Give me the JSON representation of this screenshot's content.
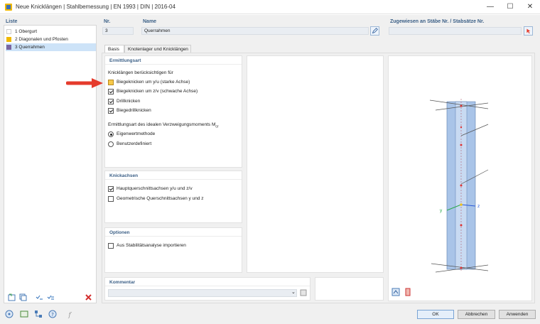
{
  "window": {
    "title": "Neue Knicklängen | Stahlbemessung | EN 1993 | DIN | 2016-04",
    "controls": [
      "—",
      "☐",
      "✕"
    ]
  },
  "sidebar": {
    "heading": "Liste",
    "items": [
      {
        "label": "1 Obergurt",
        "color": "#ffffff"
      },
      {
        "label": "2 Diagonalen und Pfosten",
        "color": "#f0b800"
      },
      {
        "label": "3 Querrahmen",
        "color": "#7a66a0"
      }
    ]
  },
  "header": {
    "nr_label": "Nr.",
    "nr_value": "3",
    "name_label": "Name",
    "name_value": "Querrahmen",
    "assigned_label": "Zugewiesen an Stäbe Nr. / Stabsätze Nr.",
    "assigned_value": ""
  },
  "tabs": [
    {
      "label": "Basis",
      "active": true
    },
    {
      "label": "Knotenlager und Knicklängen",
      "active": false
    }
  ],
  "ermittlung": {
    "heading": "Ermittlungsart",
    "subheading": "Knicklängen berücksichtigen für",
    "checkboxes": [
      {
        "label": "Biegeknicken um y/u (starke Achse)",
        "checked": false
      },
      {
        "label": "Biegeknicken um z/v (schwache Achse)",
        "checked": true
      },
      {
        "label": "Drillknicken",
        "checked": true
      },
      {
        "label": "Biegedrillknicken",
        "checked": true
      }
    ],
    "moment_label": "Ermittlungsart des idealen Verzweigungsmoments M",
    "moment_sub": "cr",
    "radios": [
      {
        "label": "Eigenwertmethode",
        "selected": true
      },
      {
        "label": "Benutzerdefiniert",
        "selected": false
      }
    ]
  },
  "knickachsen": {
    "heading": "Knickachsen",
    "checkboxes": [
      {
        "label": "Hauptquerschnittsachsen y/u und z/v",
        "checked": true
      },
      {
        "label": "Geometrische Querschnittsachsen y und z",
        "checked": false
      }
    ]
  },
  "optionen": {
    "heading": "Optionen",
    "checkbox": {
      "label": "Aus Stabilitätsanalyse importieren",
      "checked": false
    }
  },
  "kommentar": {
    "heading": "Kommentar",
    "value": ""
  },
  "preview": {
    "axis_y": "y",
    "axis_z": "z"
  },
  "footer": {
    "ok": "OK",
    "cancel": "Abbrechen",
    "apply": "Anwenden"
  },
  "colors": {
    "accent": "#3b5f86",
    "arrow": "#e53b2c",
    "beam": "#a9c4e8"
  }
}
